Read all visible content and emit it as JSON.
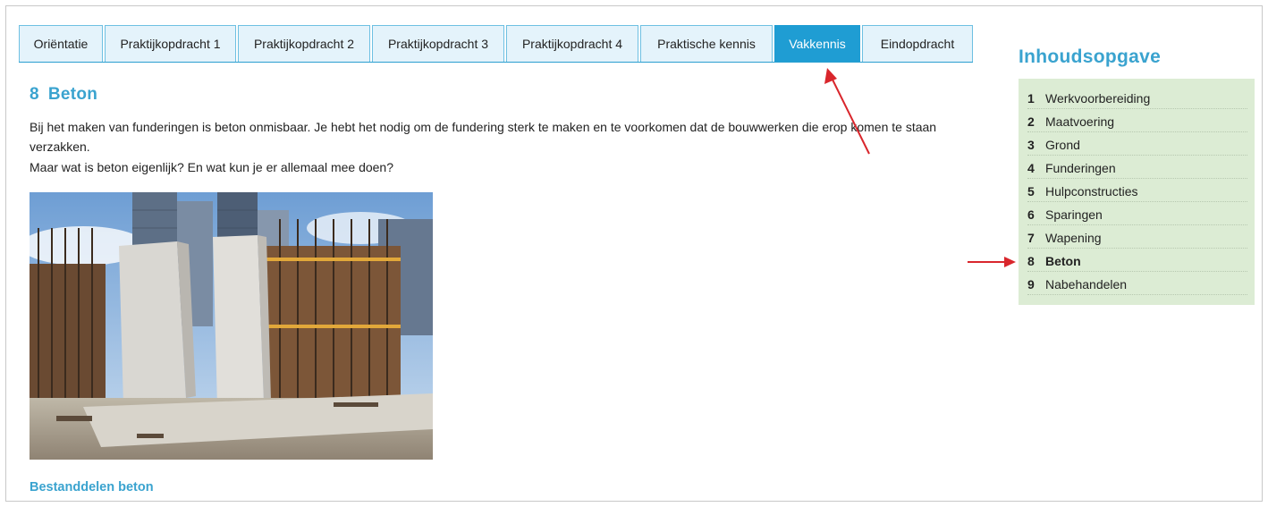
{
  "tabs": [
    {
      "label": "Oriëntatie",
      "active": false
    },
    {
      "label": "Praktijkopdracht 1",
      "active": false
    },
    {
      "label": "Praktijkopdracht 2",
      "active": false
    },
    {
      "label": "Praktijkopdracht 3",
      "active": false
    },
    {
      "label": "Praktijkopdracht 4",
      "active": false
    },
    {
      "label": "Praktische kennis",
      "active": false
    },
    {
      "label": "Vakkennis",
      "active": true
    },
    {
      "label": "Eindopdracht",
      "active": false
    }
  ],
  "main": {
    "chapter_number": "8",
    "chapter_title": "Beton",
    "paragraph_1": "Bij het maken van funderingen is beton onmisbaar. Je hebt het nodig om de fundering sterk te maken en te voorkomen dat de bouwwerken die erop komen te staan verzakken.",
    "paragraph_2": "Maar wat is beton eigenlijk? En wat kun je er allemaal mee doen?",
    "image_alt": "construction-site-concrete-walls",
    "subheading": "Bestanddelen beton"
  },
  "toc": {
    "title": "Inhoudsopgave",
    "items": [
      {
        "number": "1",
        "label": "Werkvoorbereiding",
        "current": false
      },
      {
        "number": "2",
        "label": "Maatvoering",
        "current": false
      },
      {
        "number": "3",
        "label": "Grond",
        "current": false
      },
      {
        "number": "4",
        "label": "Funderingen",
        "current": false
      },
      {
        "number": "5",
        "label": "Hulpconstructies",
        "current": false
      },
      {
        "number": "6",
        "label": "Sparingen",
        "current": false
      },
      {
        "number": "7",
        "label": "Wapening",
        "current": false
      },
      {
        "number": "8",
        "label": "Beton",
        "current": true
      },
      {
        "number": "9",
        "label": "Nabehandelen",
        "current": false
      }
    ]
  },
  "colors": {
    "accent": "#1f9dd3",
    "heading": "#3aa3cf",
    "toc_background": "#dcecd4",
    "annotation_arrow": "#d9262c"
  }
}
